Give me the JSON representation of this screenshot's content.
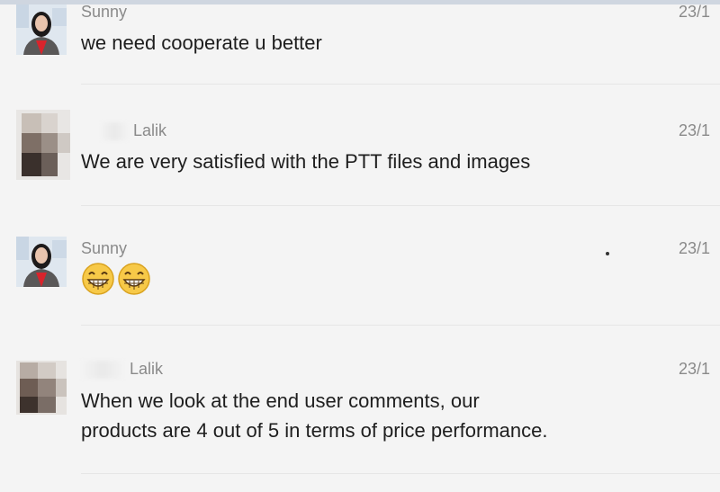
{
  "messages": [
    {
      "sender": "Sunny",
      "time": "23/1",
      "text": "we need cooperate u better",
      "avatar": "sunny-photo"
    },
    {
      "sender": "Lalik",
      "time": "23/1",
      "text": "We are very satisfied with the PTT files and images",
      "avatar": "blurred-photo"
    },
    {
      "sender": "Sunny",
      "time": "23/1",
      "emojis": [
        "grinning-face-icon",
        "grinning-face-icon"
      ],
      "avatar": "sunny-photo"
    },
    {
      "sender": "Lalik",
      "time": "23/1",
      "text_lines": [
        "When we look at the end user comments, our",
        "products are 4 out of 5 in terms of price performance."
      ],
      "avatar": "blurred-photo"
    }
  ],
  "colors": {
    "background": "#f4f4f4",
    "text": "#1e1e1e",
    "meta": "#8a8a8a"
  }
}
